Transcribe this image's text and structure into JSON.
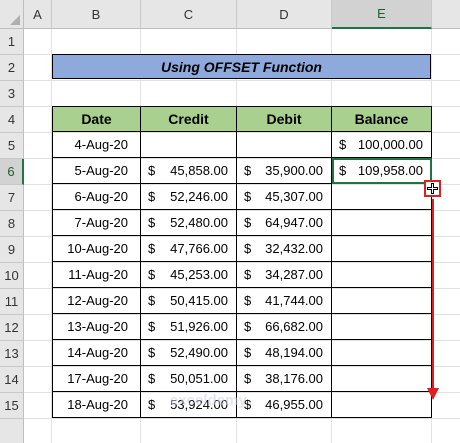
{
  "columns": [
    "A",
    "B",
    "C",
    "D",
    "E"
  ],
  "rows": [
    "1",
    "2",
    "3",
    "4",
    "5",
    "6",
    "7",
    "8",
    "9",
    "10",
    "11",
    "12",
    "13",
    "14",
    "15"
  ],
  "title": "Using OFFSET Function",
  "headers": {
    "date": "Date",
    "credit": "Credit",
    "debit": "Debit",
    "balance": "Balance"
  },
  "currency": "$",
  "table": [
    {
      "date": "4-Aug-20",
      "credit": "",
      "debit": "",
      "balance": "100,000.00"
    },
    {
      "date": "5-Aug-20",
      "credit": "45,858.00",
      "debit": "35,900.00",
      "balance": "109,958.00"
    },
    {
      "date": "6-Aug-20",
      "credit": "52,246.00",
      "debit": "45,307.00",
      "balance": ""
    },
    {
      "date": "7-Aug-20",
      "credit": "52,480.00",
      "debit": "64,947.00",
      "balance": ""
    },
    {
      "date": "10-Aug-20",
      "credit": "47,766.00",
      "debit": "32,432.00",
      "balance": ""
    },
    {
      "date": "11-Aug-20",
      "credit": "45,253.00",
      "debit": "34,287.00",
      "balance": ""
    },
    {
      "date": "12-Aug-20",
      "credit": "50,415.00",
      "debit": "41,744.00",
      "balance": ""
    },
    {
      "date": "13-Aug-20",
      "credit": "51,926.00",
      "debit": "66,682.00",
      "balance": ""
    },
    {
      "date": "14-Aug-20",
      "credit": "52,490.00",
      "debit": "48,194.00",
      "balance": ""
    },
    {
      "date": "17-Aug-20",
      "credit": "50,051.00",
      "debit": "38,176.00",
      "balance": ""
    },
    {
      "date": "18-Aug-20",
      "credit": "53,924.00",
      "debit": "46,955.00",
      "balance": ""
    }
  ],
  "active_column": "E",
  "active_row": "6",
  "watermark": "exceldemy",
  "colors": {
    "title_bg": "#8ea9db",
    "header_bg": "#a9d08e",
    "selection": "#217346",
    "drag_arrow": "#e02020"
  },
  "icons": {
    "fill_cursor": "crosshair-plus-icon",
    "drag_direction": "arrow-down-icon"
  }
}
